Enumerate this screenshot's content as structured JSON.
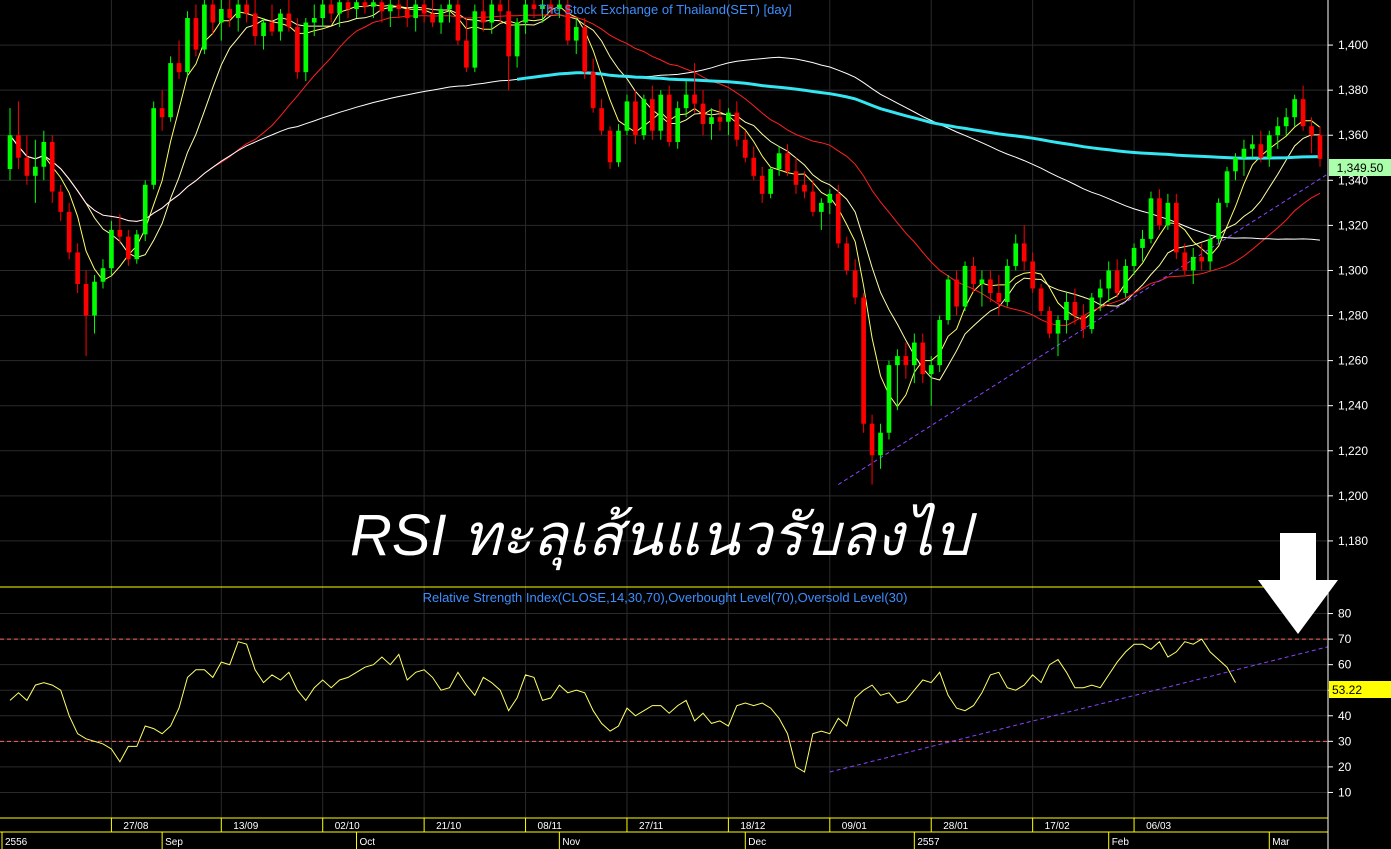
{
  "price_title": "The Stock Exchange of Thailand(SET) [day]",
  "rsi_title": "Relative Strength Index(CLOSE,14,30,70),Overbought Level(70),Oversold Level(30)",
  "overlay_text": "RSI ทะลุเส้นแนวรับลงไป",
  "last_price_label": "1,349.50",
  "last_rsi_label": "53.22",
  "colors": {
    "up": "#00ff00",
    "down": "#ff0000",
    "ma_yellow": "#ffff66",
    "ma_red": "#ff2020",
    "ma_white": "#ffffff",
    "ma_cyan": "#33e6f2",
    "trend": "#8844ff",
    "rsi_line": "#ffff66",
    "level_line": "#ff6666",
    "grid": "#2a2a2a"
  },
  "price_axis": {
    "ticks": [
      "1,400",
      "1,380",
      "1,360",
      "1,340",
      "1,320",
      "1,300",
      "1,280",
      "1,260",
      "1,240",
      "1,220",
      "1,200",
      "1,180"
    ]
  },
  "rsi_axis": {
    "ticks": [
      "80",
      "70",
      "60",
      "50",
      "40",
      "30",
      "20",
      "10"
    ]
  },
  "date_row1": [
    "27/08",
    "13/09",
    "02/10",
    "21/10",
    "08/11",
    "27/11",
    "18/12",
    "09/01",
    "28/01",
    "17/02",
    "06/03"
  ],
  "date_row2": [
    "2556",
    "Sep",
    "Oct",
    "Nov",
    "Dec",
    "2557",
    "Feb",
    "Mar"
  ],
  "chart_data": {
    "type": "candlestick",
    "index": "The Stock Exchange of Thailand(SET) [day]",
    "ylim": [
      1160,
      1420
    ],
    "last_close": 1349.5,
    "rsi": {
      "period": 14,
      "overbought": 70,
      "oversold": 30,
      "ylim": [
        0,
        90
      ],
      "last": 53.22,
      "values": [
        46,
        49,
        46,
        52,
        53,
        52,
        50,
        40,
        33,
        31,
        30,
        29,
        27,
        22,
        28,
        28,
        36,
        35,
        33,
        36,
        43,
        55,
        58,
        58,
        55,
        61,
        60,
        69,
        68,
        58,
        53,
        56,
        54,
        57,
        50,
        46,
        51,
        54,
        51,
        54,
        55,
        57,
        59,
        60,
        63,
        60,
        64,
        54,
        57,
        58,
        55,
        50,
        51,
        57,
        52,
        48,
        55,
        53,
        50,
        42,
        47,
        56,
        55,
        46,
        47,
        52,
        49,
        50,
        49,
        42,
        37,
        34,
        36,
        43,
        40,
        42,
        44,
        44,
        41,
        44,
        46,
        38,
        41,
        37,
        38,
        36,
        44,
        45,
        44,
        45,
        43,
        39,
        33,
        20,
        18,
        33,
        34,
        33,
        39,
        36,
        47,
        50,
        52,
        48,
        49,
        45,
        46,
        50,
        54,
        53,
        57,
        48,
        43,
        42,
        44,
        49,
        56,
        57,
        51,
        50,
        52,
        56,
        53,
        60,
        62,
        57,
        51,
        51,
        52,
        51,
        56,
        61,
        65,
        68,
        68,
        66,
        69,
        63,
        65,
        69,
        68,
        70,
        65,
        62,
        59,
        53
      ]
    },
    "candles": [
      {
        "o": 1345,
        "h": 1372,
        "l": 1340,
        "c": 1360
      },
      {
        "o": 1360,
        "h": 1375,
        "l": 1345,
        "c": 1350
      },
      {
        "o": 1350,
        "h": 1360,
        "l": 1338,
        "c": 1342
      },
      {
        "o": 1342,
        "h": 1358,
        "l": 1330,
        "c": 1346
      },
      {
        "o": 1346,
        "h": 1362,
        "l": 1340,
        "c": 1357
      },
      {
        "o": 1357,
        "h": 1360,
        "l": 1330,
        "c": 1335
      },
      {
        "o": 1335,
        "h": 1338,
        "l": 1322,
        "c": 1326
      },
      {
        "o": 1326,
        "h": 1330,
        "l": 1305,
        "c": 1308
      },
      {
        "o": 1308,
        "h": 1312,
        "l": 1290,
        "c": 1294
      },
      {
        "o": 1294,
        "h": 1300,
        "l": 1262,
        "c": 1280
      },
      {
        "o": 1280,
        "h": 1298,
        "l": 1272,
        "c": 1295
      },
      {
        "o": 1295,
        "h": 1305,
        "l": 1292,
        "c": 1301
      },
      {
        "o": 1301,
        "h": 1322,
        "l": 1298,
        "c": 1318
      },
      {
        "o": 1318,
        "h": 1325,
        "l": 1312,
        "c": 1315
      },
      {
        "o": 1315,
        "h": 1318,
        "l": 1302,
        "c": 1305
      },
      {
        "o": 1305,
        "h": 1318,
        "l": 1303,
        "c": 1316
      },
      {
        "o": 1316,
        "h": 1340,
        "l": 1313,
        "c": 1338
      },
      {
        "o": 1338,
        "h": 1375,
        "l": 1336,
        "c": 1372
      },
      {
        "o": 1372,
        "h": 1380,
        "l": 1362,
        "c": 1368
      },
      {
        "o": 1368,
        "h": 1395,
        "l": 1366,
        "c": 1392
      },
      {
        "o": 1392,
        "h": 1402,
        "l": 1385,
        "c": 1388
      },
      {
        "o": 1388,
        "h": 1415,
        "l": 1386,
        "c": 1412
      },
      {
        "o": 1412,
        "h": 1418,
        "l": 1395,
        "c": 1398
      },
      {
        "o": 1398,
        "h": 1420,
        "l": 1396,
        "c": 1418
      },
      {
        "o": 1418,
        "h": 1420,
        "l": 1405,
        "c": 1410
      },
      {
        "o": 1410,
        "h": 1420,
        "l": 1402,
        "c": 1416
      },
      {
        "o": 1416,
        "h": 1420,
        "l": 1408,
        "c": 1412
      },
      {
        "o": 1412,
        "h": 1420,
        "l": 1406,
        "c": 1418
      },
      {
        "o": 1418,
        "h": 1420,
        "l": 1410,
        "c": 1414
      },
      {
        "o": 1414,
        "h": 1420,
        "l": 1400,
        "c": 1404
      },
      {
        "o": 1404,
        "h": 1412,
        "l": 1398,
        "c": 1410
      },
      {
        "o": 1410,
        "h": 1418,
        "l": 1404,
        "c": 1406
      },
      {
        "o": 1406,
        "h": 1416,
        "l": 1402,
        "c": 1414
      },
      {
        "o": 1414,
        "h": 1420,
        "l": 1406,
        "c": 1408
      },
      {
        "o": 1408,
        "h": 1412,
        "l": 1385,
        "c": 1388
      },
      {
        "o": 1388,
        "h": 1412,
        "l": 1384,
        "c": 1410
      },
      {
        "o": 1410,
        "h": 1418,
        "l": 1404,
        "c": 1412
      },
      {
        "o": 1412,
        "h": 1420,
        "l": 1408,
        "c": 1418
      },
      {
        "o": 1418,
        "h": 1420,
        "l": 1410,
        "c": 1414
      },
      {
        "o": 1414,
        "h": 1420,
        "l": 1408,
        "c": 1419
      },
      {
        "o": 1419,
        "h": 1420,
        "l": 1412,
        "c": 1416
      },
      {
        "o": 1416,
        "h": 1420,
        "l": 1412,
        "c": 1419
      },
      {
        "o": 1419,
        "h": 1420,
        "l": 1414,
        "c": 1417
      },
      {
        "o": 1417,
        "h": 1420,
        "l": 1412,
        "c": 1419
      },
      {
        "o": 1419,
        "h": 1420,
        "l": 1410,
        "c": 1415
      },
      {
        "o": 1415,
        "h": 1420,
        "l": 1408,
        "c": 1418
      },
      {
        "o": 1418,
        "h": 1420,
        "l": 1412,
        "c": 1416
      },
      {
        "o": 1416,
        "h": 1420,
        "l": 1408,
        "c": 1412
      },
      {
        "o": 1412,
        "h": 1420,
        "l": 1406,
        "c": 1418
      },
      {
        "o": 1418,
        "h": 1420,
        "l": 1410,
        "c": 1414
      },
      {
        "o": 1414,
        "h": 1420,
        "l": 1408,
        "c": 1410
      },
      {
        "o": 1410,
        "h": 1418,
        "l": 1405,
        "c": 1416
      },
      {
        "o": 1416,
        "h": 1420,
        "l": 1410,
        "c": 1418
      },
      {
        "o": 1418,
        "h": 1420,
        "l": 1400,
        "c": 1402
      },
      {
        "o": 1402,
        "h": 1412,
        "l": 1388,
        "c": 1390
      },
      {
        "o": 1390,
        "h": 1418,
        "l": 1388,
        "c": 1415
      },
      {
        "o": 1415,
        "h": 1420,
        "l": 1406,
        "c": 1410
      },
      {
        "o": 1410,
        "h": 1420,
        "l": 1405,
        "c": 1418
      },
      {
        "o": 1418,
        "h": 1420,
        "l": 1410,
        "c": 1415
      },
      {
        "o": 1415,
        "h": 1420,
        "l": 1380,
        "c": 1395
      },
      {
        "o": 1395,
        "h": 1412,
        "l": 1390,
        "c": 1410
      },
      {
        "o": 1410,
        "h": 1420,
        "l": 1405,
        "c": 1418
      },
      {
        "o": 1418,
        "h": 1420,
        "l": 1412,
        "c": 1416
      },
      {
        "o": 1416,
        "h": 1420,
        "l": 1410,
        "c": 1418
      },
      {
        "o": 1418,
        "h": 1420,
        "l": 1414,
        "c": 1416
      },
      {
        "o": 1416,
        "h": 1420,
        "l": 1412,
        "c": 1418
      },
      {
        "o": 1418,
        "h": 1420,
        "l": 1400,
        "c": 1402
      },
      {
        "o": 1402,
        "h": 1412,
        "l": 1396,
        "c": 1408
      },
      {
        "o": 1408,
        "h": 1412,
        "l": 1385,
        "c": 1388
      },
      {
        "o": 1388,
        "h": 1394,
        "l": 1370,
        "c": 1372
      },
      {
        "o": 1372,
        "h": 1376,
        "l": 1360,
        "c": 1362
      },
      {
        "o": 1362,
        "h": 1364,
        "l": 1345,
        "c": 1348
      },
      {
        "o": 1348,
        "h": 1365,
        "l": 1346,
        "c": 1362
      },
      {
        "o": 1362,
        "h": 1378,
        "l": 1360,
        "c": 1375
      },
      {
        "o": 1375,
        "h": 1380,
        "l": 1356,
        "c": 1360
      },
      {
        "o": 1360,
        "h": 1378,
        "l": 1358,
        "c": 1376
      },
      {
        "o": 1376,
        "h": 1382,
        "l": 1358,
        "c": 1362
      },
      {
        "o": 1362,
        "h": 1380,
        "l": 1358,
        "c": 1378
      },
      {
        "o": 1378,
        "h": 1382,
        "l": 1355,
        "c": 1357
      },
      {
        "o": 1357,
        "h": 1375,
        "l": 1354,
        "c": 1372
      },
      {
        "o": 1372,
        "h": 1384,
        "l": 1368,
        "c": 1378
      },
      {
        "o": 1378,
        "h": 1392,
        "l": 1370,
        "c": 1374
      },
      {
        "o": 1374,
        "h": 1380,
        "l": 1360,
        "c": 1365
      },
      {
        "o": 1365,
        "h": 1372,
        "l": 1358,
        "c": 1368
      },
      {
        "o": 1368,
        "h": 1376,
        "l": 1362,
        "c": 1366
      },
      {
        "o": 1366,
        "h": 1372,
        "l": 1360,
        "c": 1370
      },
      {
        "o": 1370,
        "h": 1375,
        "l": 1355,
        "c": 1358
      },
      {
        "o": 1358,
        "h": 1362,
        "l": 1348,
        "c": 1350
      },
      {
        "o": 1350,
        "h": 1355,
        "l": 1340,
        "c": 1342
      },
      {
        "o": 1342,
        "h": 1346,
        "l": 1330,
        "c": 1334
      },
      {
        "o": 1334,
        "h": 1346,
        "l": 1332,
        "c": 1345
      },
      {
        "o": 1345,
        "h": 1355,
        "l": 1342,
        "c": 1352
      },
      {
        "o": 1352,
        "h": 1356,
        "l": 1342,
        "c": 1344
      },
      {
        "o": 1344,
        "h": 1350,
        "l": 1334,
        "c": 1338
      },
      {
        "o": 1338,
        "h": 1344,
        "l": 1332,
        "c": 1335
      },
      {
        "o": 1335,
        "h": 1340,
        "l": 1324,
        "c": 1326
      },
      {
        "o": 1326,
        "h": 1332,
        "l": 1318,
        "c": 1330
      },
      {
        "o": 1330,
        "h": 1336,
        "l": 1325,
        "c": 1334
      },
      {
        "o": 1334,
        "h": 1338,
        "l": 1310,
        "c": 1312
      },
      {
        "o": 1312,
        "h": 1315,
        "l": 1298,
        "c": 1300
      },
      {
        "o": 1300,
        "h": 1305,
        "l": 1285,
        "c": 1288
      },
      {
        "o": 1288,
        "h": 1290,
        "l": 1228,
        "c": 1232
      },
      {
        "o": 1232,
        "h": 1236,
        "l": 1205,
        "c": 1218
      },
      {
        "o": 1218,
        "h": 1232,
        "l": 1212,
        "c": 1228
      },
      {
        "o": 1228,
        "h": 1260,
        "l": 1225,
        "c": 1258
      },
      {
        "o": 1258,
        "h": 1265,
        "l": 1238,
        "c": 1262
      },
      {
        "o": 1262,
        "h": 1268,
        "l": 1252,
        "c": 1258
      },
      {
        "o": 1258,
        "h": 1272,
        "l": 1250,
        "c": 1268
      },
      {
        "o": 1268,
        "h": 1272,
        "l": 1250,
        "c": 1254
      },
      {
        "o": 1254,
        "h": 1262,
        "l": 1240,
        "c": 1258
      },
      {
        "o": 1258,
        "h": 1280,
        "l": 1255,
        "c": 1278
      },
      {
        "o": 1278,
        "h": 1298,
        "l": 1276,
        "c": 1296
      },
      {
        "o": 1296,
        "h": 1300,
        "l": 1280,
        "c": 1284
      },
      {
        "o": 1284,
        "h": 1304,
        "l": 1282,
        "c": 1302
      },
      {
        "o": 1302,
        "h": 1306,
        "l": 1290,
        "c": 1294
      },
      {
        "o": 1294,
        "h": 1300,
        "l": 1284,
        "c": 1296
      },
      {
        "o": 1296,
        "h": 1300,
        "l": 1286,
        "c": 1290
      },
      {
        "o": 1290,
        "h": 1298,
        "l": 1280,
        "c": 1286
      },
      {
        "o": 1286,
        "h": 1305,
        "l": 1284,
        "c": 1302
      },
      {
        "o": 1302,
        "h": 1316,
        "l": 1300,
        "c": 1312
      },
      {
        "o": 1312,
        "h": 1320,
        "l": 1300,
        "c": 1304
      },
      {
        "o": 1304,
        "h": 1308,
        "l": 1290,
        "c": 1292
      },
      {
        "o": 1292,
        "h": 1294,
        "l": 1280,
        "c": 1282
      },
      {
        "o": 1282,
        "h": 1284,
        "l": 1270,
        "c": 1272
      },
      {
        "o": 1272,
        "h": 1280,
        "l": 1262,
        "c": 1278
      },
      {
        "o": 1278,
        "h": 1290,
        "l": 1272,
        "c": 1286
      },
      {
        "o": 1286,
        "h": 1292,
        "l": 1276,
        "c": 1280
      },
      {
        "o": 1280,
        "h": 1285,
        "l": 1270,
        "c": 1274
      },
      {
        "o": 1274,
        "h": 1290,
        "l": 1272,
        "c": 1288
      },
      {
        "o": 1288,
        "h": 1296,
        "l": 1282,
        "c": 1292
      },
      {
        "o": 1292,
        "h": 1304,
        "l": 1286,
        "c": 1300
      },
      {
        "o": 1300,
        "h": 1305,
        "l": 1288,
        "c": 1290
      },
      {
        "o": 1290,
        "h": 1305,
        "l": 1288,
        "c": 1302
      },
      {
        "o": 1302,
        "h": 1312,
        "l": 1298,
        "c": 1310
      },
      {
        "o": 1310,
        "h": 1318,
        "l": 1304,
        "c": 1314
      },
      {
        "o": 1314,
        "h": 1335,
        "l": 1312,
        "c": 1332
      },
      {
        "o": 1332,
        "h": 1336,
        "l": 1318,
        "c": 1320
      },
      {
        "o": 1320,
        "h": 1334,
        "l": 1318,
        "c": 1330
      },
      {
        "o": 1330,
        "h": 1334,
        "l": 1305,
        "c": 1308
      },
      {
        "o": 1308,
        "h": 1312,
        "l": 1298,
        "c": 1300
      },
      {
        "o": 1300,
        "h": 1310,
        "l": 1294,
        "c": 1306
      },
      {
        "o": 1306,
        "h": 1312,
        "l": 1300,
        "c": 1304
      },
      {
        "o": 1304,
        "h": 1316,
        "l": 1300,
        "c": 1314
      },
      {
        "o": 1314,
        "h": 1332,
        "l": 1312,
        "c": 1330
      },
      {
        "o": 1330,
        "h": 1346,
        "l": 1328,
        "c": 1344
      },
      {
        "o": 1344,
        "h": 1352,
        "l": 1340,
        "c": 1350
      },
      {
        "o": 1350,
        "h": 1358,
        "l": 1342,
        "c": 1354
      },
      {
        "o": 1354,
        "h": 1360,
        "l": 1350,
        "c": 1356
      },
      {
        "o": 1356,
        "h": 1362,
        "l": 1348,
        "c": 1350
      },
      {
        "o": 1350,
        "h": 1362,
        "l": 1346,
        "c": 1360
      },
      {
        "o": 1360,
        "h": 1368,
        "l": 1354,
        "c": 1364
      },
      {
        "o": 1364,
        "h": 1372,
        "l": 1360,
        "c": 1368
      },
      {
        "o": 1368,
        "h": 1378,
        "l": 1364,
        "c": 1376
      },
      {
        "o": 1376,
        "h": 1382,
        "l": 1362,
        "c": 1364
      },
      {
        "o": 1364,
        "h": 1368,
        "l": 1352,
        "c": 1360
      },
      {
        "o": 1360,
        "h": 1364,
        "l": 1346,
        "c": 1349.5
      }
    ]
  }
}
